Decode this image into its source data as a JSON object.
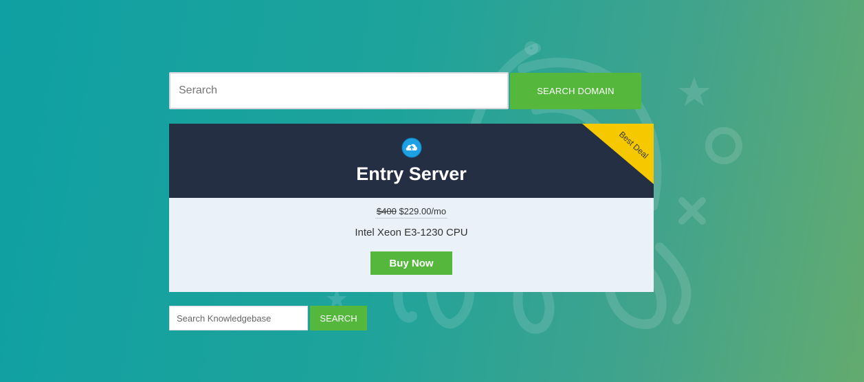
{
  "domain_search": {
    "placeholder": "Serarch",
    "button_label": "SEARCH DOMAIN"
  },
  "product": {
    "icon": "cloud-upload-icon",
    "title": "Entry Server",
    "ribbon": "Best Deal",
    "old_price": "$400",
    "new_price": "$229.00/mo",
    "description": "Intel Xeon E3-1230 CPU",
    "buy_label": "Buy Now"
  },
  "kb_search": {
    "placeholder": "Search Knowledgebase",
    "button_label": "SEARCH"
  },
  "colors": {
    "accent_green": "#55b83d",
    "card_header": "#252f43",
    "card_body": "#eaf1f8",
    "ribbon": "#f5c800"
  }
}
